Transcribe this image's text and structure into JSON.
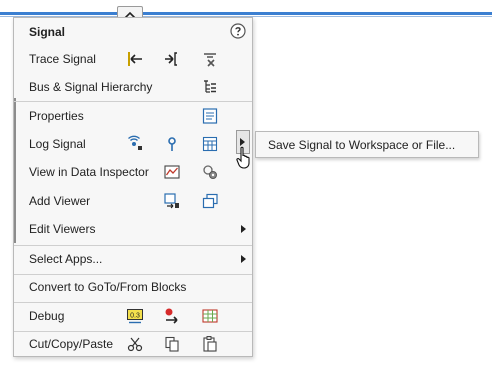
{
  "menu": {
    "header": {
      "title": "Signal",
      "help_icon": "question-circle-icon"
    },
    "items": {
      "trace_signal": "Trace Signal",
      "bus_hierarchy": "Bus & Signal Hierarchy",
      "properties": "Properties",
      "log_signal": "Log Signal",
      "view_inspector": "View in Data Inspector",
      "add_viewer": "Add Viewer",
      "edit_viewers": "Edit Viewers",
      "select_apps": "Select Apps...",
      "convert_goto": "Convert to GoTo/From Blocks",
      "debug": "Debug",
      "cut_copy_paste": "Cut/Copy/Paste"
    }
  },
  "submenu": {
    "save_signal": "Save Signal to Workspace or File..."
  },
  "colors": {
    "accent": "#3b7fd1",
    "menu_bg": "#f7f7f7"
  }
}
